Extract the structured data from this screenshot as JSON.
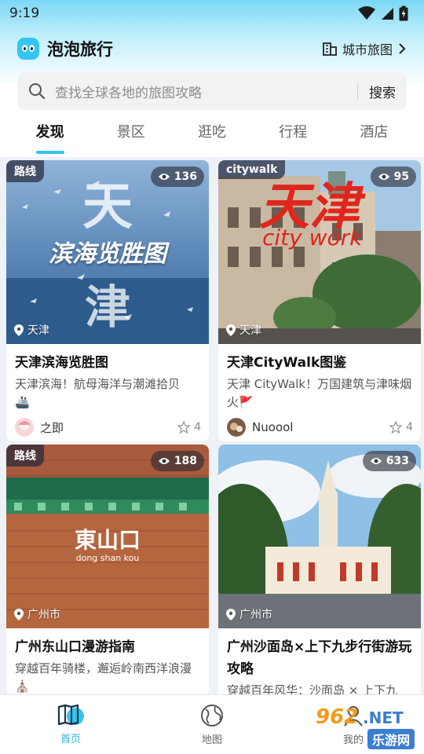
{
  "status_bar": {
    "time": "9:19"
  },
  "header": {
    "app_name": "泡泡旅行",
    "city_map_label": "城市旅图"
  },
  "search": {
    "placeholder": "查找全球各地的旅图攻略",
    "button_label": "搜索"
  },
  "tabs": [
    {
      "label": "发现",
      "active": true
    },
    {
      "label": "景区",
      "active": false
    },
    {
      "label": "逛吃",
      "active": false
    },
    {
      "label": "行程",
      "active": false
    },
    {
      "label": "酒店",
      "active": false
    }
  ],
  "cards": [
    {
      "tag": "路线",
      "views": "136",
      "location": "天津",
      "image_text_a": "天",
      "image_text_b": "滨海览胜图",
      "image_text_c": "津",
      "title": "天津滨海览胜图",
      "desc": "天津滨海！航母海洋与潮滩拾贝",
      "desc_emoji": "🚢",
      "author": "之即",
      "likes": "4"
    },
    {
      "tag": "citywalk",
      "views": "95",
      "location": "天津",
      "image_text_a": "天津",
      "image_text_b": "city work",
      "title": "天津CityWalk图鉴",
      "desc": "天津 CityWalk！万国建筑与津味烟火",
      "desc_emoji": "🚩",
      "author": "Nuoool",
      "likes": "4"
    },
    {
      "tag": "路线",
      "views": "188",
      "location": "广州市",
      "image_text_a": "東山口",
      "image_text_b": "dong shan kou",
      "title": "广州东山口漫游指南",
      "desc": "穿越百年骑楼，邂逅岭南西洋浪漫",
      "desc_emoji": "⛪"
    },
    {
      "views": "633",
      "location": "广州市",
      "title": "广州沙面岛×上下九步行街游玩攻略",
      "desc": "穿越百年风华：沙面岛 × 上下九"
    }
  ],
  "bottom_nav": [
    {
      "label": "首页",
      "active": true
    },
    {
      "label": "地图",
      "active": false
    },
    {
      "label": "我的",
      "active": false
    }
  ],
  "watermark": {
    "text_a": "962",
    "text_b": ".NET",
    "text_c": "乐游网"
  },
  "colors": {
    "accent": "#36c3ec",
    "active_nav": "#2bb5e3"
  }
}
